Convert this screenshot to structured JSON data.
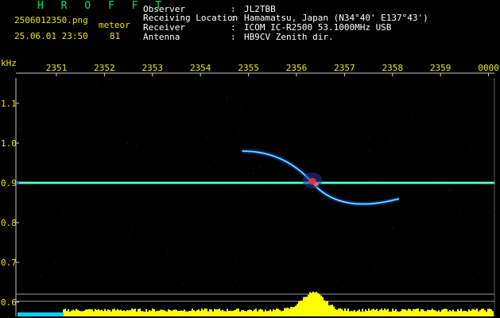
{
  "header": {
    "app_title": "H R O F F T",
    "filename": "2506012350.png",
    "datetime": "25.06.01 23:50",
    "event_type": "meteor",
    "event_count": "81"
  },
  "station_info": [
    {
      "label": "Observer",
      "value": "JL2TBB"
    },
    {
      "label": "Receiving Location",
      "value": "Hamamatsu, Japan (N34°40' E137°43')"
    },
    {
      "label": "Receiver",
      "value": "ICOM IC-R2500 53.1000MHz USB"
    },
    {
      "label": "Antenna",
      "value": "HB9CV Zenith dir."
    }
  ],
  "colors": {
    "header_title": "#00e06a",
    "labels": "#e8e800",
    "values": "#ffffff",
    "carrier_line": "#18e8b0",
    "meteor_trace": "#30c0ff",
    "noise_bars": "#ffff00",
    "background": "#000000"
  },
  "chart_data": {
    "type": "spectrogram",
    "y_unit_label": "kHz",
    "y_ticks": [
      "1.1",
      "1.0",
      "0.9",
      "0.8",
      "0.7",
      "0.6"
    ],
    "x_ticks": [
      "2351",
      "2352",
      "2353",
      "2354",
      "2355",
      "2356",
      "2357",
      "2358",
      "2359",
      "0000"
    ],
    "carrier_freq_khz": 0.9,
    "meteor_echo": {
      "start_time": "2355",
      "end_time": "2358",
      "start_freq_khz": 0.98,
      "end_freq_khz": 0.86,
      "peak_time": "2356"
    }
  }
}
